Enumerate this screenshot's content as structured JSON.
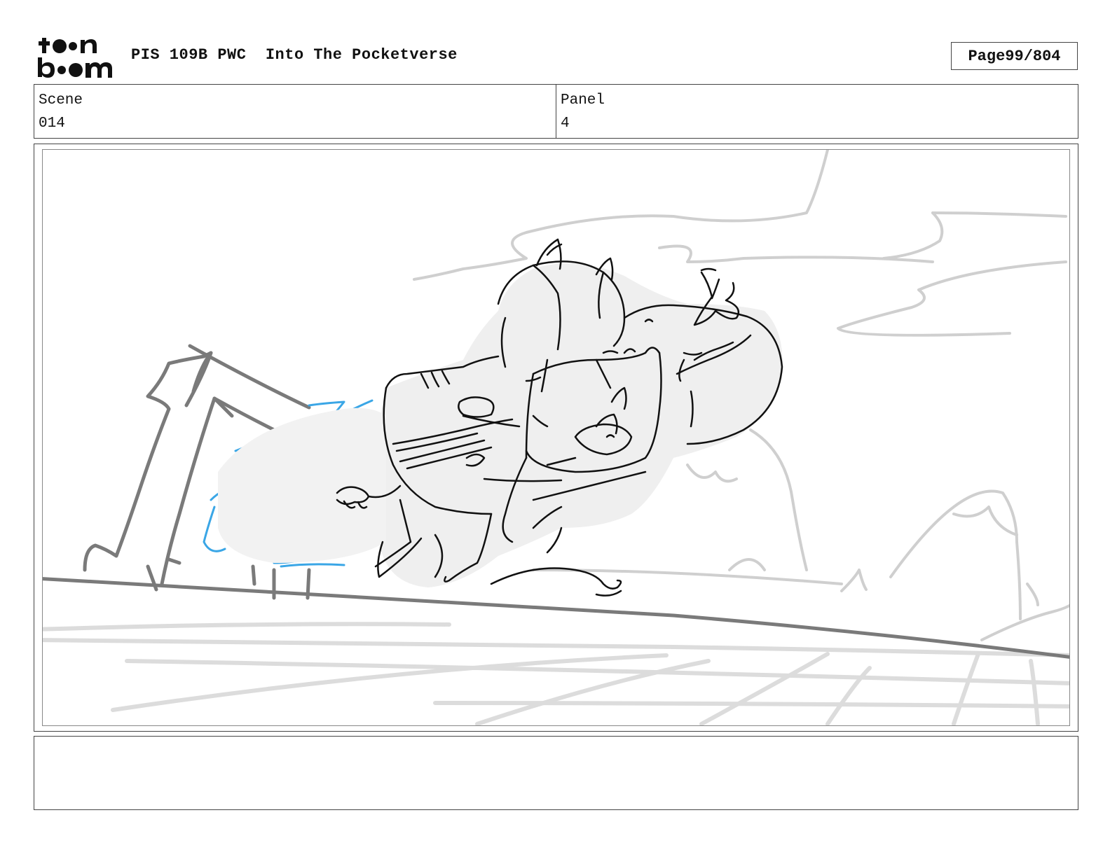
{
  "header": {
    "logo_text": "toon boom",
    "project": "PIS 109B PWC",
    "episode": "Into The Pocketverse",
    "page_label": "Page",
    "page_value": "99/804"
  },
  "info": {
    "scene_label": "Scene",
    "scene_value": "014",
    "panel_label": "Panel",
    "panel_value": "4"
  },
  "notes": {
    "text": ""
  }
}
